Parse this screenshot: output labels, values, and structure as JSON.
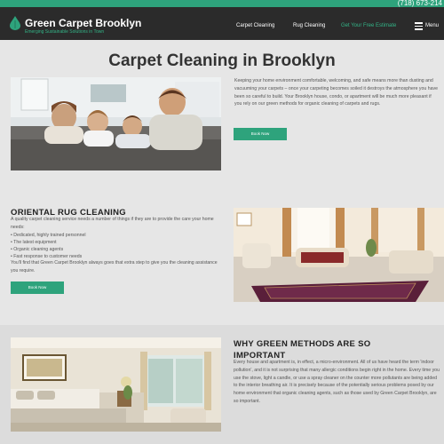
{
  "topbar": {
    "phone": "(718) 673-214"
  },
  "header": {
    "brand": "Green Carpet Brooklyn",
    "tagline": "Emerging Sustainable Solutions in Town",
    "nav": [
      {
        "label": "Carpet Cleaning"
      },
      {
        "label": "Rug Cleaning"
      },
      {
        "label": "Get Your Free Estimate"
      }
    ],
    "menu_label": "Menu"
  },
  "hero": {
    "title": "Carpet Cleaning in Brooklyn",
    "paragraph": "Keeping your home environment comfortable, welcoming, and safe means more than dusting and vacuuming your carpets – once your carpeting becomes soiled it destroys the atmosphere you have been so careful to build. Your Brooklyn house, condo, or apartment will be much more pleasant if you rely on our green methods for organic cleaning of carpets and rugs.",
    "button": "Book Now"
  },
  "oriental": {
    "title": "ORIENTAL RUG CLEANING",
    "intro": "A quality carpet cleaning service needs a number of things if they are to provide the care your home needs:",
    "items": [
      "Dedicated, highly trained personnel",
      "The latest equipment",
      "Organic cleaning agents",
      "Fast response to customer needs"
    ],
    "outro": "You'll find that Green Carpet Brooklyn always goes that extra step to give you the cleaning assistance you require.",
    "button": "Book Now"
  },
  "green": {
    "title_line1": "WHY GREEN METHODS ARE SO",
    "title_line2": "IMPORTANT",
    "paragraph": "Every house and apartment is, in effect, a micro-environment. All of us have heard the term 'indoor pollution', and it is not surprising that many allergic conditions begin right in the home. Every time you use the stove, light a candle, or use a spray cleaner on the counter more pollutants are being added to the interior breathing air. It is precisely because of the potentially serious problems posed by our home environment that organic cleaning agents, such as those used by Green Carpet Brooklyn, are so important."
  },
  "colors": {
    "accent": "#2ea37c",
    "nav_bg": "#2b2b2b",
    "page_bg": "#e6e6e6"
  }
}
